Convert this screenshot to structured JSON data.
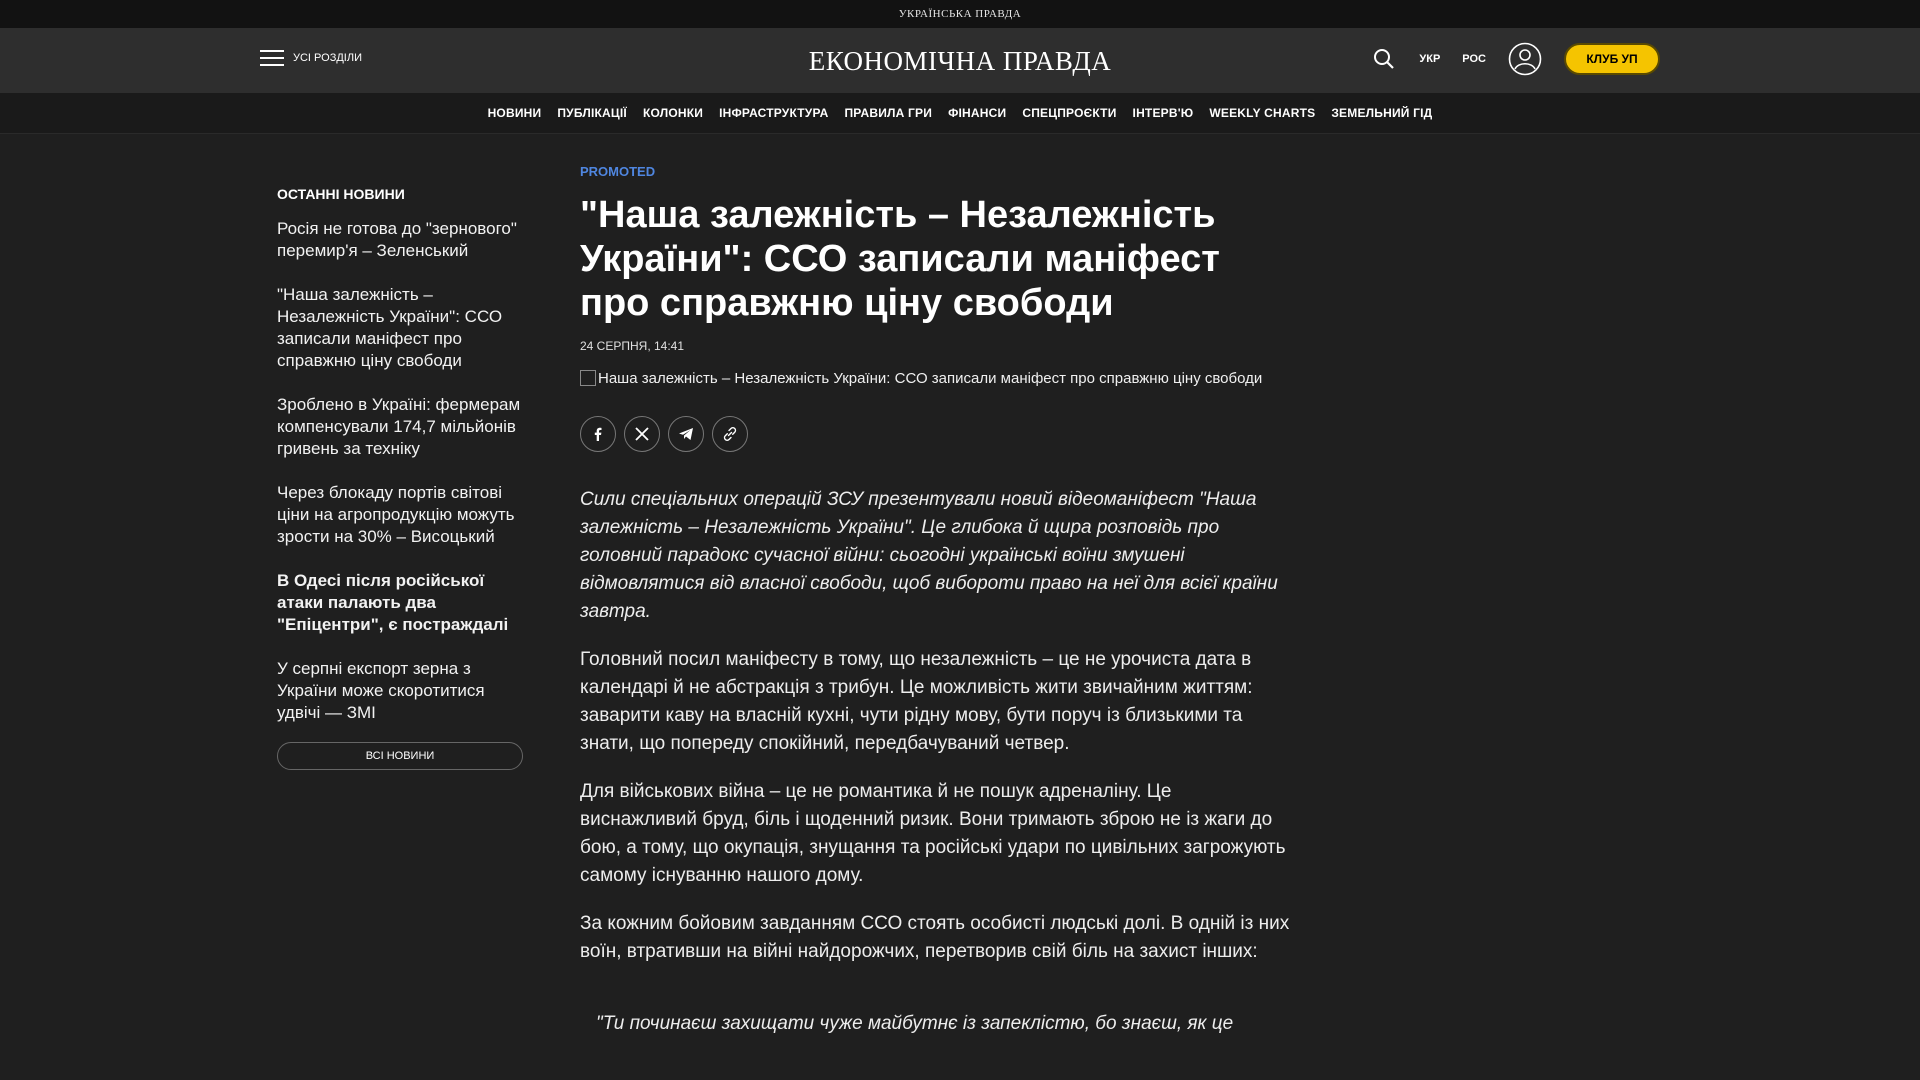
{
  "topbar": {
    "brand": "УКРАЇНСЬКА ПРАВДА"
  },
  "header": {
    "menu_label": "УСІ РОЗДІЛИ",
    "logo": "ЕКОНОМІЧНА ПРАВДА",
    "lang_ukr": "УКР",
    "lang_ros": "РОС",
    "club_label": "КЛУБ УП"
  },
  "nav": {
    "items": [
      "НОВИНИ",
      "ПУБЛІКАЦІЇ",
      "КОЛОНКИ",
      "ІНФРАСТРУКТУРА",
      "ПРАВИЛА ГРИ",
      "ФІНАНСИ",
      "СПЕЦПРОЄКТИ",
      "ІНТЕРВ'Ю",
      "WEEKLY CHARTS",
      "ЗЕМЕЛЬНИЙ ГІД"
    ]
  },
  "sidebar": {
    "title": "ОСТАННІ НОВИНИ",
    "items": [
      "Росія не готова до \"зернового\" перемир'я – Зеленський",
      "\"Наша залежність – Незалежність України\": ССО записали маніфест про справжню ціну свободи",
      "Зроблено в Україні: фермерам компенсували 174,7 мільйонів гривень за техніку",
      "Через блокаду портів світові ціни на агропродукцію можуть зрости на 30% – Висоцький",
      "В Одесі після російської атаки палають два \"Епіцентри\", є постраждалі",
      "У серпні експорт зерна з України може скоротитися удвічі — ЗМІ"
    ],
    "all_news_label": "ВСІ НОВИНИ"
  },
  "article": {
    "badge": "PROMOTED",
    "title": "\"Наша залежність – Незалежність України\": ССО записали маніфест про справжню ціну свободи",
    "date": "24 СЕРПНЯ, 14:41",
    "image_alt": "Наша залежність – Незалежність України: ССО записали маніфест про справжню ціну свободи",
    "lead": "Сили спеціальних операцій ЗСУ презентували новий відеоманіфест \"Наша залежність – Незалежність України\". Це глибока й щира розповідь про головний парадокс сучасної війни: сьогодні українські воїни змушені відмовлятися від власної свободи, щоб виборoти право на неї для всієї країни завтра.",
    "paragraphs": [
      "Головний посил маніфесту в тому, що незалежність – це не урочиста дата в календарі й не абстракція з трибун. Це можливість жити звичайним життям: заварити каву на власній кухні, чути рідну мову, бути поруч із близькими та знати, що попереду спокійний, передбачуваний четвер.",
      "Для військових війна – це не романтика й не пошук адреналіну. Це виснажливий бруд, біль і щоденний ризик. Вони тримають зброю не із жаги до бою, а тому, що окупація, знущання та російські удари по цивільних загрожують самому існуванню нашого дому.",
      "За кожним бойовим завданням ССО стоять особисті людські долі. В одній із них воїн, втративши на війні найдорожчих, перетворив свій біль на захист інших:"
    ],
    "quote": "\"Ти починаєш захищати чуже майбутнє із запеклістю, бо знаєш, як це"
  },
  "colors": {
    "accent": "#4f86e0",
    "club": "#f5c400",
    "background": "#1f1f1f"
  },
  "icons": [
    "search-icon",
    "user-icon",
    "facebook-icon",
    "x-icon",
    "telegram-icon",
    "link-icon",
    "hamburger-icon"
  ]
}
